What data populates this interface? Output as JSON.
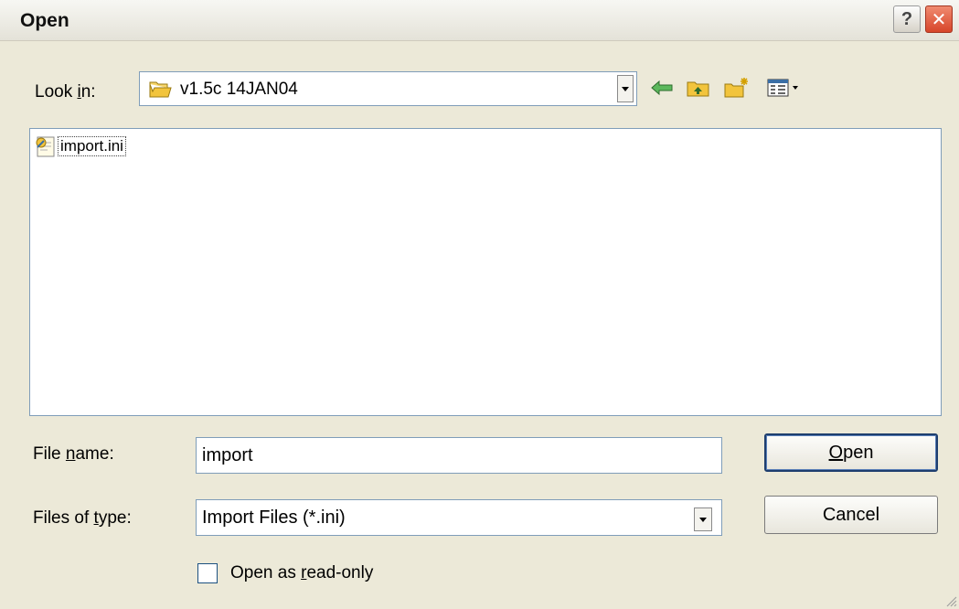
{
  "window": {
    "title": "Open",
    "help_symbol": "?",
    "close_symbol": "✕"
  },
  "look_in": {
    "label_pre": "Look ",
    "label_key": "i",
    "label_post": "n:",
    "value": "v1.5c 14JAN04"
  },
  "toolbar": {
    "icons": [
      "back-arrow-icon",
      "up-one-level-icon",
      "create-new-folder-icon",
      "view-menu-icon"
    ]
  },
  "file_list": {
    "items": [
      {
        "name": "import.ini",
        "icon": "ini-settings-file-icon"
      }
    ]
  },
  "file_name": {
    "label_pre": "File ",
    "label_key": "n",
    "label_post": "ame:",
    "value": "import"
  },
  "file_type": {
    "label_pre": "Files of ",
    "label_key": "t",
    "label_post": "ype:",
    "value": "Import Files (*.ini)"
  },
  "buttons": {
    "open_key": "O",
    "open_rest": "pen",
    "cancel": "Cancel"
  },
  "readonly": {
    "label_pre": "Open as ",
    "label_key": "r",
    "label_post": "ead-only",
    "checked": false
  },
  "colors": {
    "dialog_bg": "#ece9d8",
    "field_border": "#7f9db9",
    "close_button": "#d7452a",
    "folder_yellow": "#f2c43c"
  }
}
